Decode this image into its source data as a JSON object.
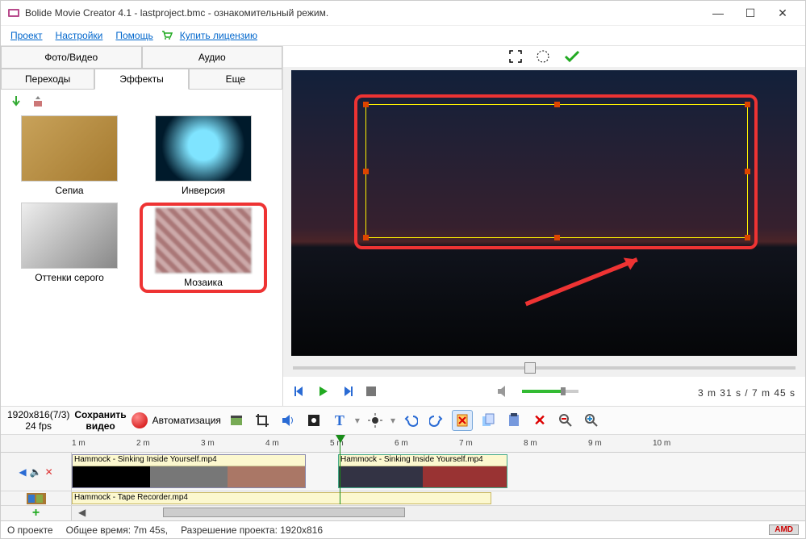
{
  "window": {
    "title": "Bolide Movie Creator 4.1 - lastproject.bmc  - ознакомительный режим."
  },
  "menu": {
    "project": "Проект",
    "settings": "Настройки",
    "help": "Помощь",
    "buy": "Купить лицензию"
  },
  "tabs": {
    "photo_video": "Фото/Видео",
    "audio": "Аудио",
    "transitions": "Переходы",
    "effects": "Эффекты",
    "more": "Еще"
  },
  "effects": {
    "sepia": "Сепиа",
    "inversion": "Инверсия",
    "grayscale": "Оттенки серого",
    "mosaic": "Мозаика"
  },
  "playback": {
    "current": "3 m 31 s",
    "separator": " / ",
    "total": "7 m 45 s"
  },
  "timeline_toolbar": {
    "resolution_info": "1920x816(7/3)",
    "fps_info": "24 fps",
    "save_video_l1": "Сохранить",
    "save_video_l2": "видео",
    "automation": "Автоматизация"
  },
  "ruler": {
    "ticks": [
      "1 m",
      "2 m",
      "3 m",
      "4 m",
      "5 m",
      "6 m",
      "7 m",
      "8 m",
      "9 m",
      "10 m"
    ]
  },
  "clips": {
    "v1": "Hammock - Sinking Inside Yourself.mp4",
    "v2": "Hammock - Sinking Inside Yourself.mp4",
    "a1": "Hammock - Tape Recorder.mp4"
  },
  "status": {
    "about": "О проекте",
    "duration": "Общее время:  7m 45s,",
    "resolution": "Разрешение проекта:    1920x816",
    "amd": "AMD"
  }
}
